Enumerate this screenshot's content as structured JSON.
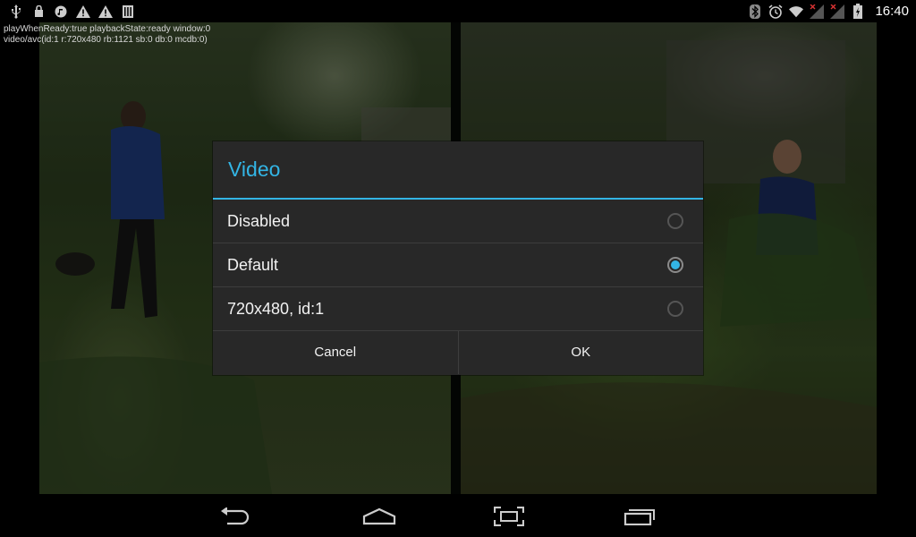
{
  "status_bar": {
    "left_icons": [
      "usb-icon",
      "lock-icon",
      "music-icon",
      "warning-icon",
      "warning-icon",
      "storage-icon"
    ],
    "right_icons": [
      "bluetooth-icon",
      "alarm-icon",
      "wifi-icon",
      "signal-icon",
      "signal-icon",
      "battery-icon"
    ],
    "time": "16:40"
  },
  "debug": {
    "line1": "playWhenReady:true playbackState:ready window:0",
    "line2": "video/avc(id:1 r:720x480 rb:1121 sb:0 db:0 mcdb:0)"
  },
  "dialog": {
    "title": "Video",
    "accent_color": "#33b5e5",
    "options": [
      {
        "label": "Disabled",
        "selected": false
      },
      {
        "label": "Default",
        "selected": true
      },
      {
        "label": "720x480, id:1",
        "selected": false
      }
    ],
    "cancel_label": "Cancel",
    "ok_label": "OK"
  },
  "nav_bar": {
    "icons": [
      "back-icon",
      "home-icon",
      "screenshot-icon",
      "recents-icon"
    ]
  }
}
